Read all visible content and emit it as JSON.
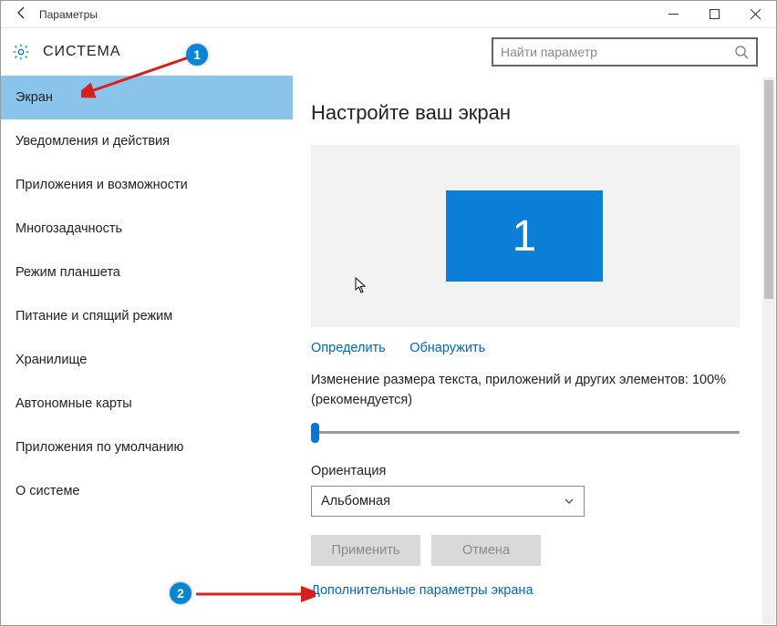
{
  "window": {
    "title": "Параметры"
  },
  "header": {
    "section": "СИСТЕМА",
    "search_placeholder": "Найти параметр"
  },
  "sidebar": {
    "items": [
      "Экран",
      "Уведомления и действия",
      "Приложения и возможности",
      "Многозадачность",
      "Режим планшета",
      "Питание и спящий режим",
      "Хранилище",
      "Автономные карты",
      "Приложения по умолчанию",
      "О системе"
    ],
    "selected_index": 0
  },
  "main": {
    "heading": "Настройте ваш экран",
    "monitor_number": "1",
    "identify_link": "Определить",
    "detect_link": "Обнаружить",
    "scale_text": "Изменение размера текста, приложений и других элементов: 100% (рекомендуется)",
    "orientation_label": "Ориентация",
    "orientation_value": "Альбомная",
    "apply_btn": "Применить",
    "cancel_btn": "Отмена",
    "advanced_link": "Дополнительные параметры экрана"
  },
  "annotations": {
    "badge1": "1",
    "badge2": "2"
  }
}
